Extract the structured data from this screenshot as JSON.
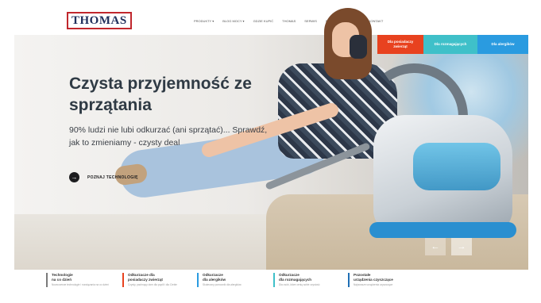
{
  "header": {
    "logo": "THOMAS",
    "nav": [
      "PRODUKTY ▾",
      "BLOG MOCY ▾",
      "GDZIE KUPIĆ",
      "THOMAS",
      "SERWIS",
      "PORADY SPRZĄTANIA",
      "KONTAKT"
    ]
  },
  "hero": {
    "title": "Czysta przyjemność ze sprzątania",
    "subtitle": "90% ludzi nie lubi odkurzać (ani sprzątać)... Sprawdź, jak to zmieniamy - czysty deal",
    "cta_label": "POZNAJ TECHNOLOGIĘ",
    "cta_icon": "→"
  },
  "categories": [
    {
      "label": "Dla posiadaczy zwierząt",
      "color": "#e8421f"
    },
    {
      "label": "Dla rozmagających",
      "color": "#3fc0c9"
    },
    {
      "label": "Dla alergików",
      "color": "#2a9be0"
    }
  ],
  "slider": {
    "prev": "←",
    "next": "→"
  },
  "features": [
    {
      "title": "Technologie\nna co dzień",
      "desc": "Nowoczesne technologie i rozwiązania na co dzień"
    },
    {
      "title": "Odkurzacze dla\nposiadaczy zwierząt",
      "desc": "Czysty, pachnący dom dla pupili i dla Ciebie"
    },
    {
      "title": "Odkurzacze\ndla alergików",
      "desc": "Skuteczny pomocnik dla alergików"
    },
    {
      "title": "Odkurzacze\ndla rozmagających",
      "desc": "Dla osób, które cenią sobie czystość"
    },
    {
      "title": "Pozostałe\nurządzenia czyszczące",
      "desc": "Najnowsze urządzenia czyszczące"
    }
  ],
  "colors": {
    "accent_orange": "#e8421f",
    "accent_teal": "#3fc0c9",
    "accent_blue": "#2a9be0",
    "logo_red": "#c0272d",
    "logo_navy": "#1f2f5c"
  }
}
